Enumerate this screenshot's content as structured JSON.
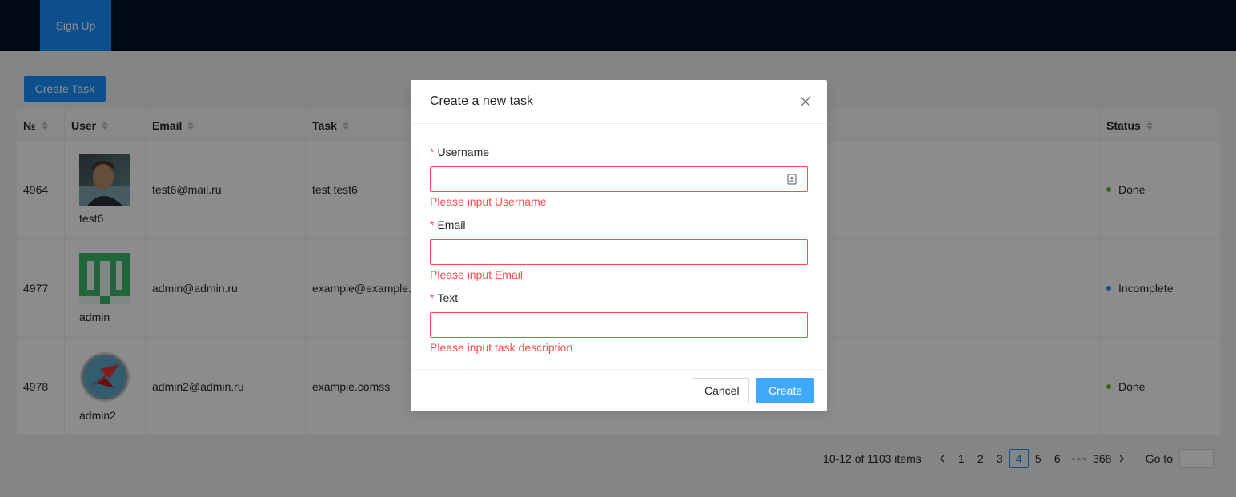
{
  "header": {
    "nav_item": "Sign Up"
  },
  "toolbar": {
    "create_task_label": "Create Task"
  },
  "table": {
    "columns": [
      "№",
      "User",
      "Email",
      "Task",
      "Status"
    ],
    "rows": [
      {
        "id": "4964",
        "user": "test6",
        "email": "test6@mail.ru",
        "task": "test test6",
        "status": "Done",
        "status_color": "#52c41a"
      },
      {
        "id": "4977",
        "user": "admin",
        "email": "admin@admin.ru",
        "task": "example@example.c",
        "status": "Incomplete",
        "status_color": "#1890ff"
      },
      {
        "id": "4978",
        "user": "admin2",
        "email": "admin2@admin.ru",
        "task": "example.comss",
        "status": "Done",
        "status_color": "#52c41a"
      }
    ]
  },
  "pagination": {
    "total_text": "10-12 of 1103 items",
    "pages": [
      "1",
      "2",
      "3",
      "4",
      "5",
      "6"
    ],
    "current_page": "4",
    "ellipsis": "•••",
    "last_page": "368",
    "goto_label": "Go to"
  },
  "modal": {
    "title": "Create a new task",
    "fields": [
      {
        "required_mark": "*",
        "label": "Username",
        "value": "",
        "error": "Please input Username"
      },
      {
        "required_mark": "*",
        "label": "Email",
        "value": "",
        "error": "Please input Email"
      },
      {
        "required_mark": "*",
        "label": "Text",
        "value": "",
        "error": "Please input task description"
      }
    ],
    "cancel_label": "Cancel",
    "create_label": "Create"
  },
  "colors": {
    "primary": "#1890ff",
    "header_bg": "#001529",
    "error": "#ff4d4f",
    "done": "#52c41a",
    "incomplete": "#1890ff"
  }
}
